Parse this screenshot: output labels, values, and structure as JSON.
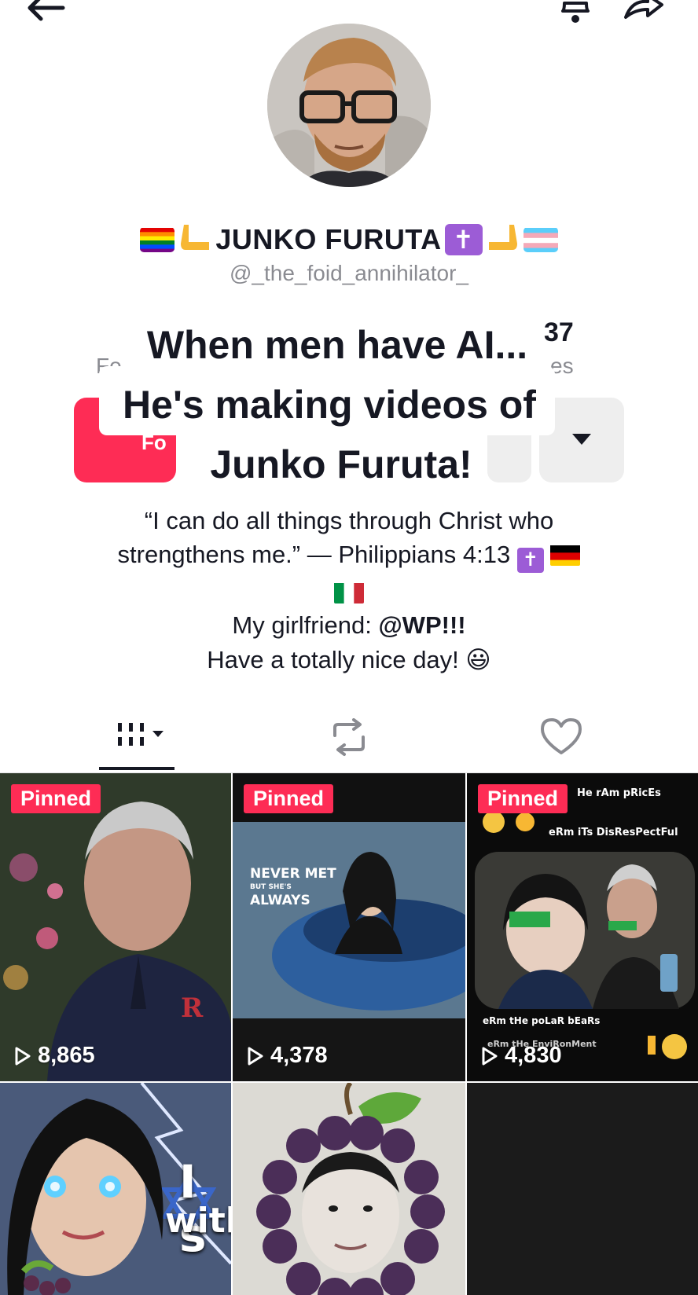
{
  "header": {
    "back_icon": "arrow-left-icon",
    "bell_icon": "bell-icon",
    "share_icon": "share-icon"
  },
  "profile": {
    "display_name": "JUNKO FURUTA",
    "handle": "@_the_foid_annihilator_",
    "name_emojis_left": [
      "rainbow-flag",
      "🫷"
    ],
    "name_emojis_right": [
      "✝️",
      "🫸",
      "transgender-flag"
    ]
  },
  "stats": {
    "following_label_fragment": "Fo",
    "likes_number_fragment": "37",
    "likes_label_fragment": "es"
  },
  "actions": {
    "follow_label": "Fo"
  },
  "overlay_caption": {
    "line1": "When men have AI...",
    "line2": "He's making videos of",
    "line3": "Junko Furuta!"
  },
  "bio": {
    "line1": "“I can do all things through Christ who",
    "line2": "strengthens me.” — Philippians 4:13",
    "line3_prefix": "My girlfriend: ",
    "line3_mention": "@WP!!!",
    "line4": "Have a totally nice day! 😃"
  },
  "tabs": [
    {
      "name": "videos",
      "icon": "grid-columns-icon"
    },
    {
      "name": "reposts",
      "icon": "repost-icon"
    },
    {
      "name": "liked",
      "icon": "heart-outline-icon"
    }
  ],
  "videos": [
    {
      "pinned": "Pinned",
      "views": "8,865"
    },
    {
      "pinned": "Pinned",
      "views": "4,378",
      "overlay_text": [
        "NEVER MET",
        "BUT SHE'S",
        "ALWAYS"
      ]
    },
    {
      "pinned": "Pinned",
      "views": "4,830",
      "overlay_text": [
        "He rAm pRicEs",
        "eRm iTs DisResPectFul",
        "eRm tHe poLaR bEaRs",
        "eRm tHe EnviRonMent"
      ]
    },
    {
      "overlay_text": [
        "I s",
        "with"
      ]
    },
    {},
    {}
  ],
  "colors": {
    "accent": "#fe2c55",
    "text": "#161823",
    "muted": "#8a8b91"
  }
}
